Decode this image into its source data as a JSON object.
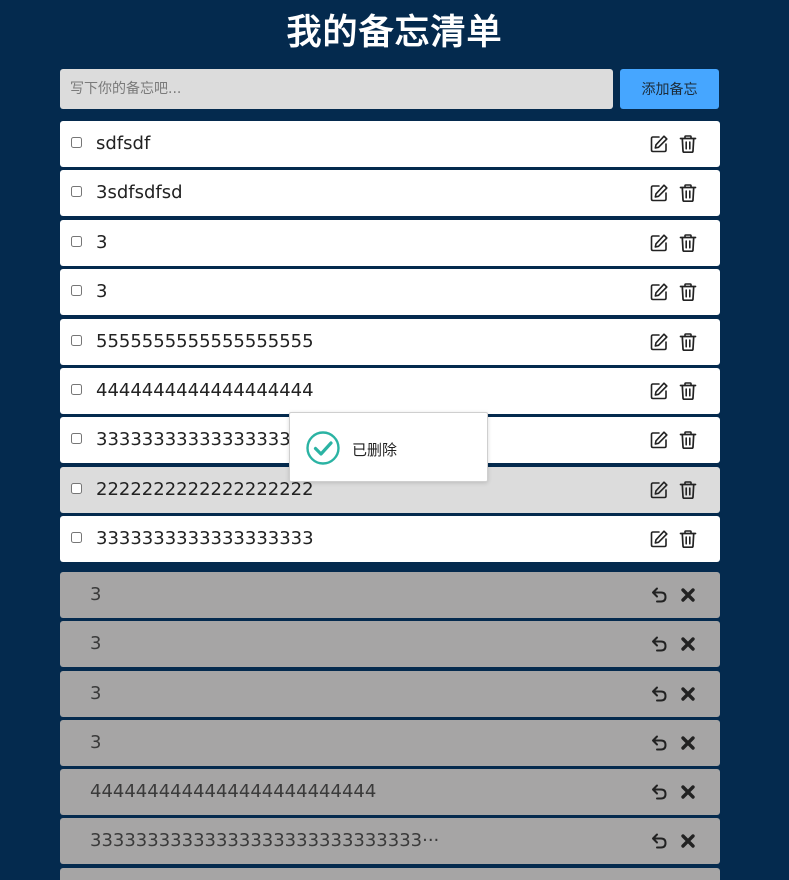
{
  "title": "我的备忘清单",
  "input": {
    "placeholder": "写下你的备忘吧...",
    "value": ""
  },
  "add_button": "添加备忘",
  "todos": [
    {
      "text": "sdfsdf",
      "checked": false
    },
    {
      "text": "3sdfsdfsd",
      "checked": false
    },
    {
      "text": "3",
      "checked": false
    },
    {
      "text": "3",
      "checked": false
    },
    {
      "text": "5555555555555555555",
      "checked": false
    },
    {
      "text": "4444444444444444444",
      "checked": false
    },
    {
      "text": "3333333333333333333",
      "checked": false
    },
    {
      "text": "2222222222222222222",
      "checked": false,
      "highlighted": true
    },
    {
      "text": "3333333333333333333",
      "checked": false
    }
  ],
  "todo_actions": {
    "edit_icon": "edit-icon",
    "delete_icon": "trash-icon"
  },
  "done": [
    {
      "text": "3"
    },
    {
      "text": "3"
    },
    {
      "text": "3"
    },
    {
      "text": "3"
    },
    {
      "text": "4444444444444444444444444"
    },
    {
      "text": "33333333333333333333333333333···"
    },
    {
      "text": ""
    }
  ],
  "done_actions": {
    "restore_icon": "undo-icon",
    "remove_icon": "close-x-icon"
  },
  "toast": {
    "message": "已删除",
    "icon": "check-circle-icon"
  },
  "colors": {
    "background": "#042a4e",
    "accent": "#46a6ff",
    "row": "#ffffff",
    "row_highlight": "#dcdcdc",
    "done_row": "#a6a5a5",
    "toast_check": "#2bb3a3"
  }
}
